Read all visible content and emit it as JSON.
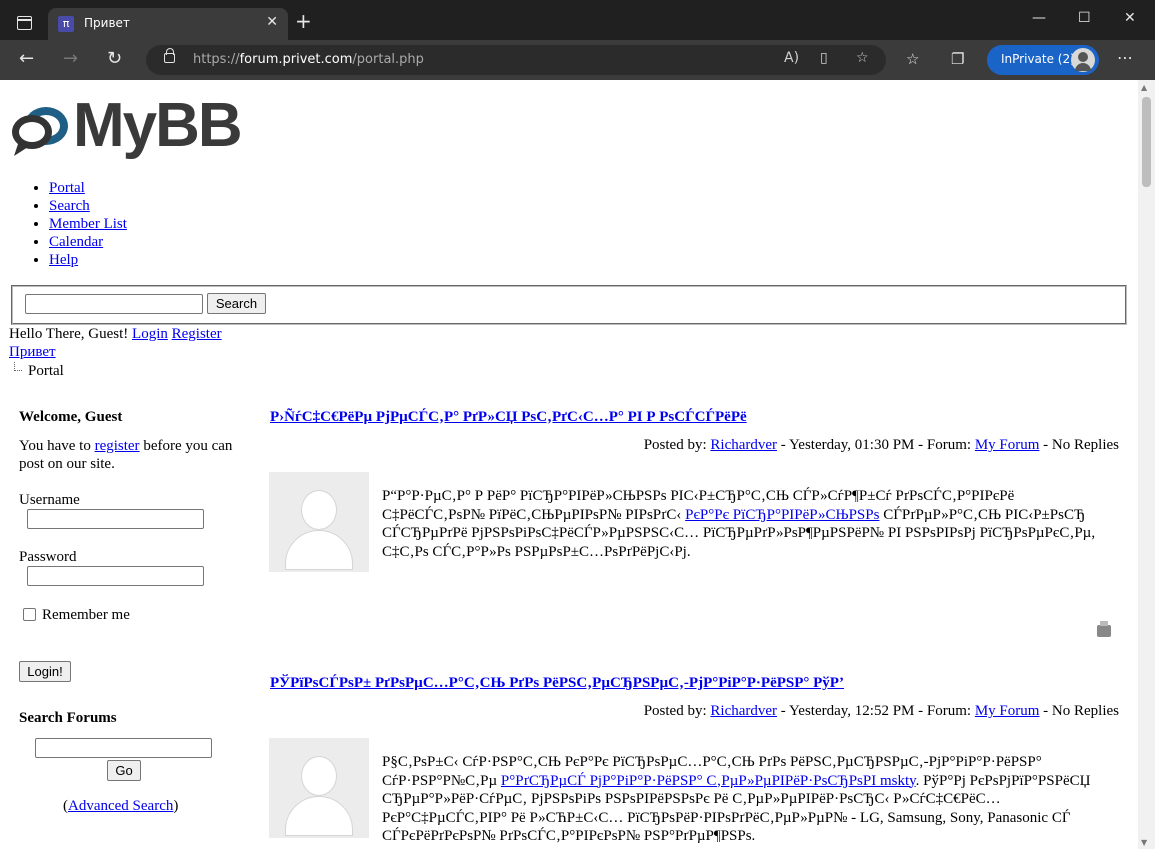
{
  "browser": {
    "tab_title": "Привет",
    "favicon_text": "π",
    "url_scheme": "https://",
    "url_host": "forum.privet.com",
    "url_path": "/portal.php",
    "inprivate_label": "InPrivate (2)"
  },
  "logo_text": "MyBB",
  "nav": [
    "Portal",
    "Search",
    "Member List",
    "Calendar",
    "Help"
  ],
  "search": {
    "button": "Search"
  },
  "greeting": {
    "text": "Hello There, Guest!",
    "login": "Login",
    "register": "Register"
  },
  "breadcrumb": {
    "parent": "Привет",
    "current": "Portal"
  },
  "sidebar": {
    "welcome_heading": "Welcome, Guest",
    "welcome_pre": "You have to ",
    "welcome_link": "register",
    "welcome_post": " before you can post on our site.",
    "username_label": "Username",
    "password_label": "Password",
    "remember_label": "Remember me",
    "login_button": "Login!",
    "search_heading": "Search Forums",
    "go_button": "Go",
    "advanced_link": "Advanced Search"
  },
  "posts": [
    {
      "title": "Р›ÑѓС‡С€РёРµ РјРµСЃС‚Р° РґР»СЏ РѕС‚РґС‹С…Р° РІ Р РѕСЃСЃРёРё",
      "posted_by_label": "Posted by: ",
      "author": "Richardver",
      "time": " - Yesterday, 01:30 PM - Forum: ",
      "forum": "My Forum",
      "replies": " - No Replies",
      "body_pre": "Р“Р°Р·РµС‚Р° Р РёР° РїСЂР°РІРёР»СЊРЅРѕ РІС‹Р±СЂР°С‚СЊ СЃР»СѓР¶Р±Сѓ РґРѕСЃС‚Р°РІРєРё С‡РёСЃС‚РѕР№ РїРёС‚СЊРµРІРѕР№ РІРѕРґС‹ ",
      "body_link": "РєР°Рє РїСЂР°РІРёР»СЊРЅРѕ",
      "body_post": " СЃРґРµР»Р°С‚СЊ РІС‹Р±РѕСЂ СЃСЂРµРґРё РјРЅРѕРіРѕС‡РёСЃР»РµРЅРЅС‹С… РїСЂРµРґР»РѕР¶РµРЅРёР№ РІ РЅРѕРІРѕРј РїСЂРѕРµРєС‚Рµ, С‡С‚Рѕ СЃС‚Р°Р»Рѕ РЅРµРѕР±С…РѕРґРёРјС‹Рј."
    },
    {
      "title": "РЎРїРѕСЃРѕР± РґРѕРµС…Р°С‚СЊ РґРѕ РёРЅС‚РµСЂРЅРµС‚-РјР°РіР°Р·РёРЅР° РўР’",
      "posted_by_label": "Posted by: ",
      "author": "Richardver",
      "time": " - Yesterday, 12:52 PM - Forum: ",
      "forum": "My Forum",
      "replies": " - No Replies",
      "body_pre": "Р§С‚РѕР±С‹ СѓР·РЅР°С‚СЊ РєР°Рє РїСЂРѕРµС…Р°С‚СЊ РґРѕ РёРЅС‚РµСЂРЅРµС‚-РјР°РіР°Р·РёРЅР° СѓР·РЅР°Р№С‚Рµ ",
      "body_link": "Р°РґСЂРµСЃ РјР°РіР°Р·РёРЅР° С‚РµР»РµРІРёР·РѕСЂРѕРІ mskty",
      "body_post": ". РўР°Рј РєРѕРјРїР°РЅРёСЏ СЂРµР°Р»РёР·СѓРµС‚ РјРЅРѕРіРѕ РЅРѕРІРёРЅРѕРє Рё С‚РµР»РµРІРёР·РѕСЂС‹ Р»СѓС‡С€РёС… РєР°С‡РµСЃС‚РІР° Рё Р»СЋР±С‹С… РїСЂРѕРёР·РІРѕРґРёС‚РµР»РµР№ - LG, Samsung, Sony, Panasonic СЃ СЃРєРёРґРєРѕР№ РґРѕСЃС‚Р°РІРєРѕР№ РЅР°РґРµР¶РЅРѕ."
    }
  ],
  "icons": [
    "tab-actions-icon",
    "close-icon",
    "new-tab-icon",
    "minimize-icon",
    "maximize-icon",
    "window-close-icon",
    "back-icon",
    "forward-icon",
    "refresh-icon",
    "lock-icon",
    "read-aloud-icon",
    "immersive-reader-icon",
    "add-favorite-icon",
    "favorites-icon",
    "collections-icon",
    "more-icon",
    "print-icon",
    "avatar-placeholder-icon"
  ]
}
